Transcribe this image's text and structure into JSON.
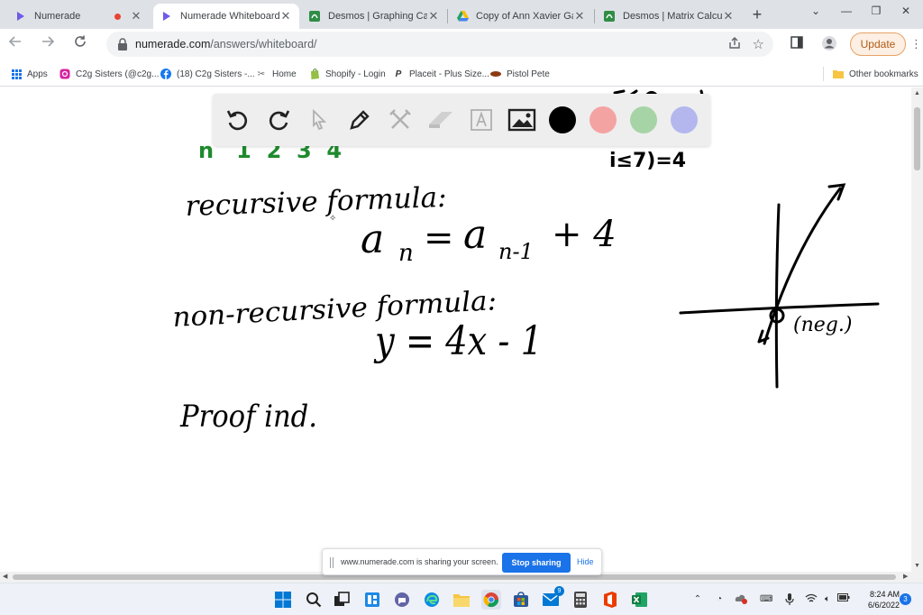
{
  "browser": {
    "tabs": [
      {
        "title": "Numerade",
        "icon": "numerade-icon",
        "active": false,
        "recording": true
      },
      {
        "title": "Numerade Whiteboard",
        "icon": "numerade-icon",
        "active": true
      },
      {
        "title": "Desmos | Graphing Calcul…",
        "icon": "desmos-icon",
        "active": false
      },
      {
        "title": "Copy of Ann Xavier Gante…",
        "icon": "drive-icon",
        "active": false
      },
      {
        "title": "Desmos | Matrix Calculator",
        "icon": "desmos-icon",
        "active": false
      }
    ],
    "new_tab_label": "+",
    "window_controls": [
      "chevron-down-icon",
      "minimize-icon",
      "restore-icon",
      "close-icon"
    ],
    "address": {
      "domain": "numerade.com",
      "path": "/answers/whiteboard/"
    },
    "update_label": "Update",
    "bookmarks": [
      {
        "label": "Apps",
        "icon": "apps-grid-icon"
      },
      {
        "label": "C2g Sisters (@c2g...",
        "icon": "instagram-icon"
      },
      {
        "label": "(18) C2g Sisters -...",
        "icon": "facebook-icon"
      },
      {
        "label": "Home",
        "icon": "home-tool-icon"
      },
      {
        "label": "Shopify - Login",
        "icon": "shopify-icon"
      },
      {
        "label": "Placeit - Plus Size...",
        "icon": "placeit-icon"
      },
      {
        "label": "Pistol Pete",
        "icon": "pistol-pete-icon"
      }
    ],
    "other_bookmarks_label": "Other bookmarks"
  },
  "whiteboard": {
    "tools": [
      "undo-icon",
      "redo-icon",
      "select-icon",
      "pen-icon",
      "tools-icon",
      "eraser-icon",
      "text-icon",
      "image-icon"
    ],
    "colors": [
      "#000000",
      "#f4a3a3",
      "#a6d4a6",
      "#b3b7ee"
    ],
    "handwriting": {
      "top_row": "n   1  2  3  4",
      "top_right": "i≤7)=4",
      "recursive_label": "recursive formula:",
      "recursive_formula_base": "a",
      "recursive_formula_sub_n": "n",
      "recursive_formula_eq": "=",
      "recursive_formula_sub_n1": "n-1",
      "recursive_formula_tail": "+ 4",
      "nonrecursive_label": "non-recursive formula:",
      "nonrecursive_formula": "y = 4x - 1",
      "proof_label": "Proof ind.",
      "graph_annotation": "(neg.)"
    }
  },
  "sharing_bar": {
    "message": "www.numerade.com is sharing your screen.",
    "stop_label": "Stop sharing",
    "hide_label": "Hide"
  },
  "taskbar": {
    "apps": [
      "windows-start-icon",
      "search-icon",
      "task-view-icon",
      "widgets-icon",
      "teams-chat-icon",
      "edge-icon",
      "file-explorer-icon",
      "chrome-icon",
      "store-icon",
      "mail-icon",
      "calculator-icon",
      "office-icon",
      "excel-icon"
    ],
    "mail_badge": "9",
    "time": "8:24 AM",
    "date": "6/6/2022",
    "notification_count": "3"
  }
}
